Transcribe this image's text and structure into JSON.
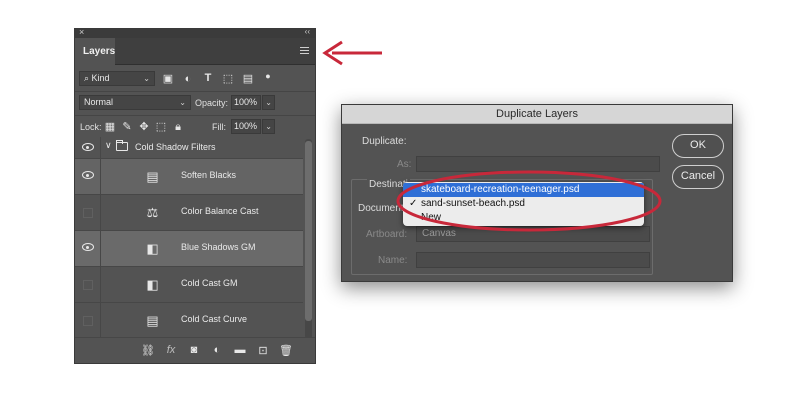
{
  "layers_panel": {
    "close_glyph": "×",
    "collapse_glyph": "‹‹",
    "tab_label": "Layers",
    "filter": {
      "kind_label": "Kind"
    },
    "blend_mode": "Normal",
    "opacity_label": "Opacity:",
    "opacity_value": "100%",
    "lock_label": "Lock:",
    "fill_label": "Fill:",
    "fill_value": "100%",
    "group": {
      "name": "Cold Shadow Filters"
    },
    "layers": [
      {
        "name": "Soften Blacks",
        "visible": true,
        "icon": "curves-icon"
      },
      {
        "name": "Color Balance Cast",
        "visible": false,
        "icon": "color-balance-icon"
      },
      {
        "name": "Blue Shadows GM",
        "visible": true,
        "icon": "gradient-map-icon"
      },
      {
        "name": "Cold Cast GM",
        "visible": false,
        "icon": "gradient-map-icon"
      },
      {
        "name": "Cold Cast Curve",
        "visible": false,
        "icon": "curves-icon"
      }
    ],
    "fx_label": "fx"
  },
  "dialog": {
    "title": "Duplicate Layers",
    "duplicate_label": "Duplicate:",
    "as_label": "As:",
    "destination_label": "Destinati",
    "document_label": "Document",
    "artboard_label": "Artboard:",
    "artboard_value": "Canvas",
    "name_label": "Name:",
    "ok_label": "OK",
    "cancel_label": "Cancel",
    "document_menu": {
      "items": [
        {
          "label": "skateboard-recreation-teenager.psd",
          "highlighted": true,
          "checked": false
        },
        {
          "label": "sand-sunset-beach.psd",
          "highlighted": false,
          "checked": true
        },
        {
          "label": "New",
          "highlighted": false,
          "checked": false
        }
      ],
      "check_glyph": "✓"
    }
  },
  "colors": {
    "panel_bg": "#535353",
    "menu_highlight": "#2f6fd6",
    "annotation_red": "#c8283a"
  }
}
